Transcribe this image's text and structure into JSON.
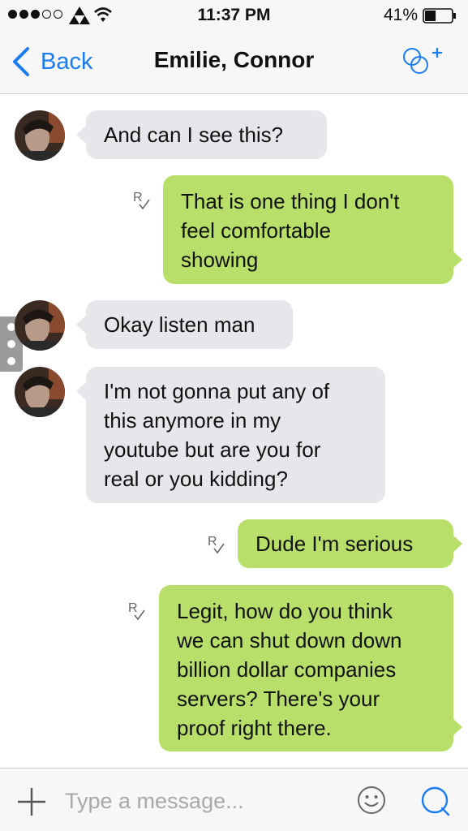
{
  "status_bar": {
    "time": "11:37 PM",
    "battery_percent": "41%",
    "signal_bars_filled": 3,
    "signal_bars_total": 5,
    "battery_level": 0.41,
    "icons": [
      "signal-dots-icon",
      "carrier-triforce-icon",
      "wifi-icon",
      "battery-icon"
    ]
  },
  "nav": {
    "back_label": "Back",
    "title": "Emilie, Connor",
    "icons": [
      "chevron-left-icon",
      "add-people-icon"
    ]
  },
  "colors": {
    "accent": "#1a7cf5",
    "incoming_bubble": "#e6e6eb",
    "outgoing_bubble": "#b8df6a"
  },
  "messages": [
    {
      "direction": "incoming",
      "text_lines": [
        "And can I see this?"
      ],
      "avatar": true
    },
    {
      "direction": "outgoing",
      "text_lines": [
        "That is one thing I don't",
        "feel comfortable",
        "showing"
      ],
      "read_mark": "R✓"
    },
    {
      "direction": "incoming",
      "text_lines": [
        "Okay listen man"
      ],
      "avatar": true
    },
    {
      "direction": "incoming",
      "text_lines": [
        "I'm not gonna put any of",
        "this anymore in my",
        "youtube but are you for",
        "real or you kidding?"
      ],
      "avatar": true
    },
    {
      "direction": "outgoing",
      "text_lines": [
        "Dude I'm serious"
      ],
      "read_mark": "R✓"
    },
    {
      "direction": "outgoing",
      "text_lines": [
        "Legit, how do you think",
        "we can shut down down",
        "billion dollar companies",
        "servers? There's your",
        "proof right there."
      ],
      "read_mark": "R✓"
    }
  ],
  "composer": {
    "placeholder": "Type a message...",
    "value": "",
    "icons": [
      "plus-icon",
      "smiley-icon",
      "send-icon"
    ]
  }
}
